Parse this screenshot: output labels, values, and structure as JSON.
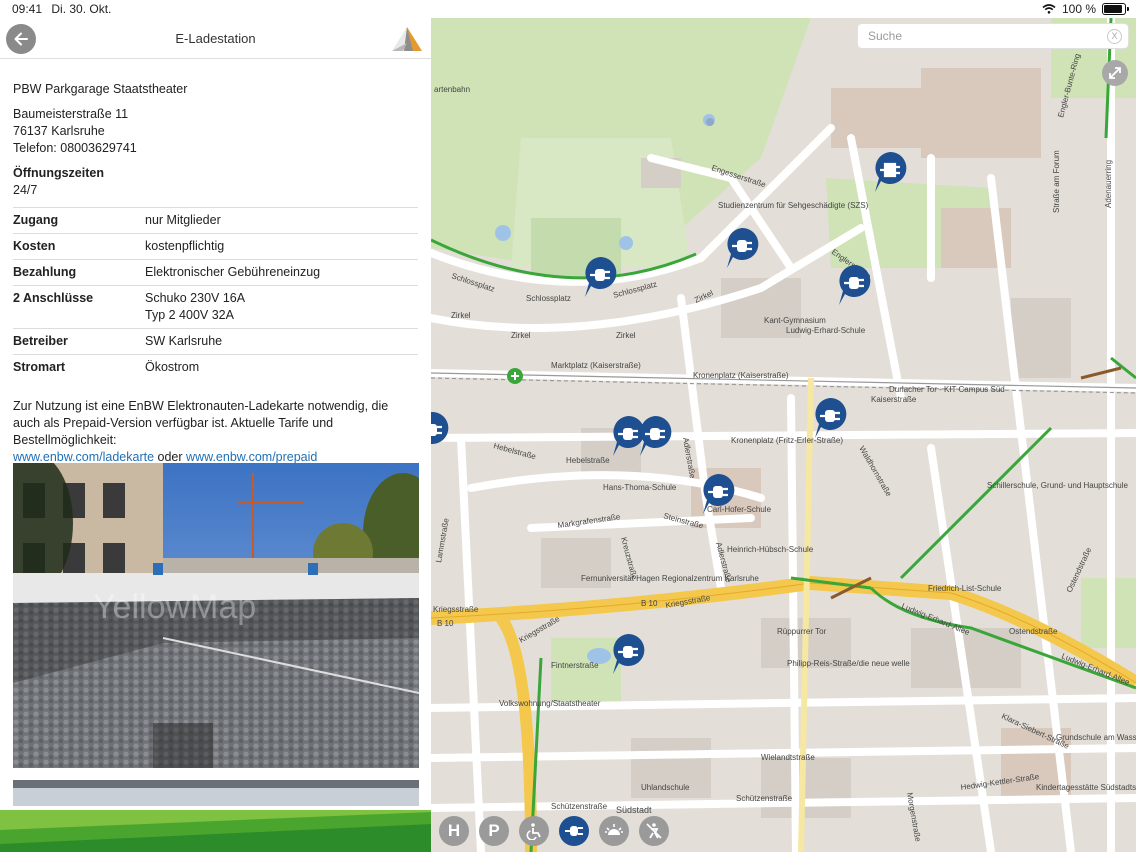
{
  "status": {
    "time": "09:41",
    "date": "Di. 30. Okt.",
    "battery": "100 %",
    "battery_level": 1.0
  },
  "nav": {
    "title": "E-Ladestation",
    "back_icon": "arrow-left-icon",
    "logo_icon": "triangle-logo-icon"
  },
  "station": {
    "name": "PBW Parkgarage Staatstheater",
    "street": "Baumeisterstraße 11",
    "city": "76137 Karlsruhe",
    "phone": "Telefon: 08003629741",
    "hours_label": "Öffnungszeiten",
    "hours_value": "24/7"
  },
  "details": [
    {
      "key": "Zugang",
      "value": "nur Mitglieder"
    },
    {
      "key": "Kosten",
      "value": "kostenpflichtig"
    },
    {
      "key": "Bezahlung",
      "value": "Elektronischer Gebühreneinzug"
    },
    {
      "key": "2 Anschlüsse",
      "value": "Schuko 230V 16A",
      "value2": "Typ 2 400V 32A"
    },
    {
      "key": "Betreiber",
      "value": "SW Karlsruhe"
    },
    {
      "key": "Stromart",
      "value": "Ökostrom"
    }
  ],
  "note": {
    "text": "Zur Nutzung ist eine EnBW Elektronauten-Ladekarte notwendig, die auch als Prepaid-Version verfügbar ist. Aktuelle Tarife und Bestellmöglichkeit:",
    "link1": "www.enbw.com/ladekarte",
    "connector": "oder",
    "link2": "www.enbw.com/prepaid"
  },
  "photo": {
    "watermark": "YellowMap"
  },
  "map": {
    "search_placeholder": "Suche",
    "clear_label": "X",
    "labels": {
      "gartenbahn": "artenbahn",
      "engesser": "Engesserstraße",
      "studienzentrum": "Studienzentrum für Sehgeschädigte (SZS)",
      "schlossplatz1": "Schlossplatz",
      "schlossplatz2": "Schlossplatz",
      "schlossplatz3": "Schlossplatz",
      "zirkel1": "Zirkel",
      "zirkel2": "Zirkel",
      "zirkel3": "Zirkel",
      "zirkel4": "Zirkel",
      "englerstr": "Englerstraße",
      "kantgym": "Kant-Gymnasium",
      "ludwigerhard": "Ludwig-Erhard-Schule",
      "marktplatz": "Marktplatz (Kaiserstraße)",
      "kronenplatz": "Kronenplatz (Kaiserstraße)",
      "durlacher": "Durlacher Tor - KIT Campus Süd",
      "kaiserstr": "Kaiserstraße",
      "kronenplatz2": "Kronenplatz (Fritz-Erler-Straße)",
      "hebel": "Hebelstraße",
      "hebel2": "Hebelstraße",
      "hansthoma": "Hans-Thoma-Schule",
      "carlhofer": "Carl-Hofer-Schule",
      "markgrafen": "Markgrafenstraße",
      "stein": "Steinstraße",
      "heinrich": "Heinrich-Hübsch-Schule",
      "schiller": "Schillerschule, Grund- und Hauptschule",
      "fernuni": "Fernuniversität Hagen Regionalzentrum Karlsruhe",
      "b10a": "B 10",
      "b10b": "B 10",
      "kriegsstr": "Kriegsstraße",
      "kriegsstr2": "Kriegsstraße",
      "kriegsstr3": "Kriegsstraße",
      "friedrichlist": "Friedrich-List-Schule",
      "ludwigallee": "Ludwig-Erhard-Allee",
      "ludwigallee2": "Ludwig-Erhard-Allee",
      "ostend": "Ostendstraße",
      "rueppurrer": "Rüppurrer Tor",
      "philipp": "Philipp-Reis-Straße/die neue welle",
      "fintner": "Fintnerstraße",
      "volkswohnung": "Volkswohnung/Staatstheater",
      "uhland": "Uhlandschule",
      "wieland": "Wielandtstraße",
      "schuetzen": "Schützenstraße",
      "schuetzen2": "Schützenstraße",
      "suedstadt": "Südstadt",
      "hedwig": "Hedwig-Kettler-Straße",
      "kita": "Kindertagesstätte Südstadtschwestern",
      "grundschule": "Grundschule am Wasserturm",
      "klara": "Klara-Siebert-Straße",
      "strasse_forum": "Straße am Forum",
      "adenauer": "Adenauerring",
      "englerbunte": "Engler-Bunte-Ring",
      "lammstr": "Lammstraße",
      "adlerstr": "Adlerstraße",
      "kreuzstr": "Kreuzstraße",
      "adlerstr2": "Adlerstraße",
      "waldhorn": "Waldhornstraße",
      "morgenstr": "Morgenstraße",
      "ostendstr2": "Ostendstraße"
    }
  },
  "filters": [
    {
      "label": "H",
      "icon": "bus-stop-icon"
    },
    {
      "label": "P",
      "icon": "parking-icon"
    },
    {
      "label": "",
      "icon": "wheelchair-icon"
    },
    {
      "label": "",
      "icon": "ev-plug-icon"
    },
    {
      "label": "",
      "icon": "sunrise-icon"
    },
    {
      "label": "",
      "icon": "no-accessibility-icon"
    }
  ]
}
